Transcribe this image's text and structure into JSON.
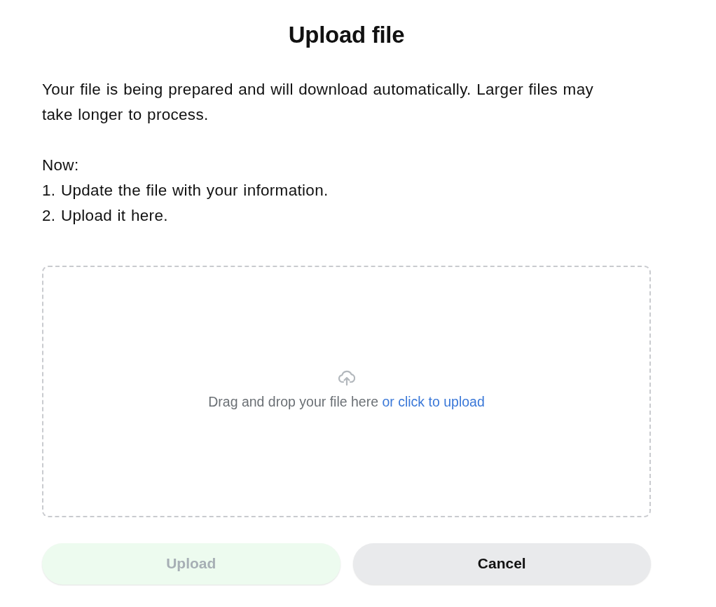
{
  "dialog": {
    "title": "Upload file",
    "intro": "Your file is being prepared and will download automatically. Larger files may take longer to process.",
    "steps_heading": "Now:",
    "steps": [
      "1. Update the file with your information.",
      "2. Upload it here."
    ]
  },
  "dropzone": {
    "text": "Drag and drop your file here",
    "link": "or click to upload"
  },
  "buttons": [
    {
      "label": "Upload",
      "kind": "primary",
      "disabled": true
    },
    {
      "label": "Cancel",
      "kind": "secondary",
      "disabled": false
    }
  ]
}
